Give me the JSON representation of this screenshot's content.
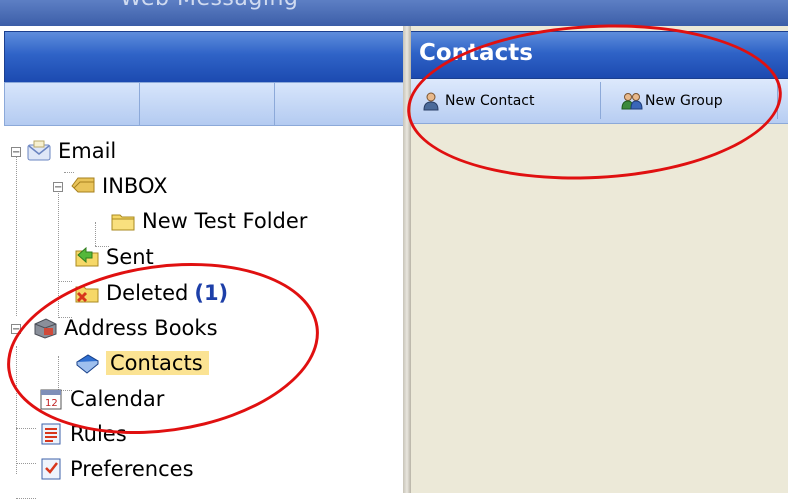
{
  "app": {
    "banner_title": "Web Messaging"
  },
  "folder_tree": {
    "email": {
      "label": "Email"
    },
    "inbox": {
      "label": "INBOX"
    },
    "new_test_folder": {
      "label": "New Test Folder"
    },
    "sent": {
      "label": "Sent"
    },
    "deleted": {
      "label": "Deleted",
      "unread_count": "(1)"
    },
    "address_books": {
      "label": "Address Books"
    },
    "contacts": {
      "label": "Contacts"
    },
    "calendar": {
      "label": "Calendar"
    },
    "rules": {
      "label": "Rules"
    },
    "preferences": {
      "label": "Preferences"
    }
  },
  "contacts_pane": {
    "title": "Contacts",
    "toolbar": {
      "new_contact_label": "New Contact",
      "new_group_label": "New Group"
    }
  },
  "colors": {
    "header_blue": "#2f63c7",
    "selection_highlight": "#fbe393",
    "annotation_red": "#e01010",
    "pane_background": "#ece9d8",
    "count_blue": "#1d3fa8"
  }
}
